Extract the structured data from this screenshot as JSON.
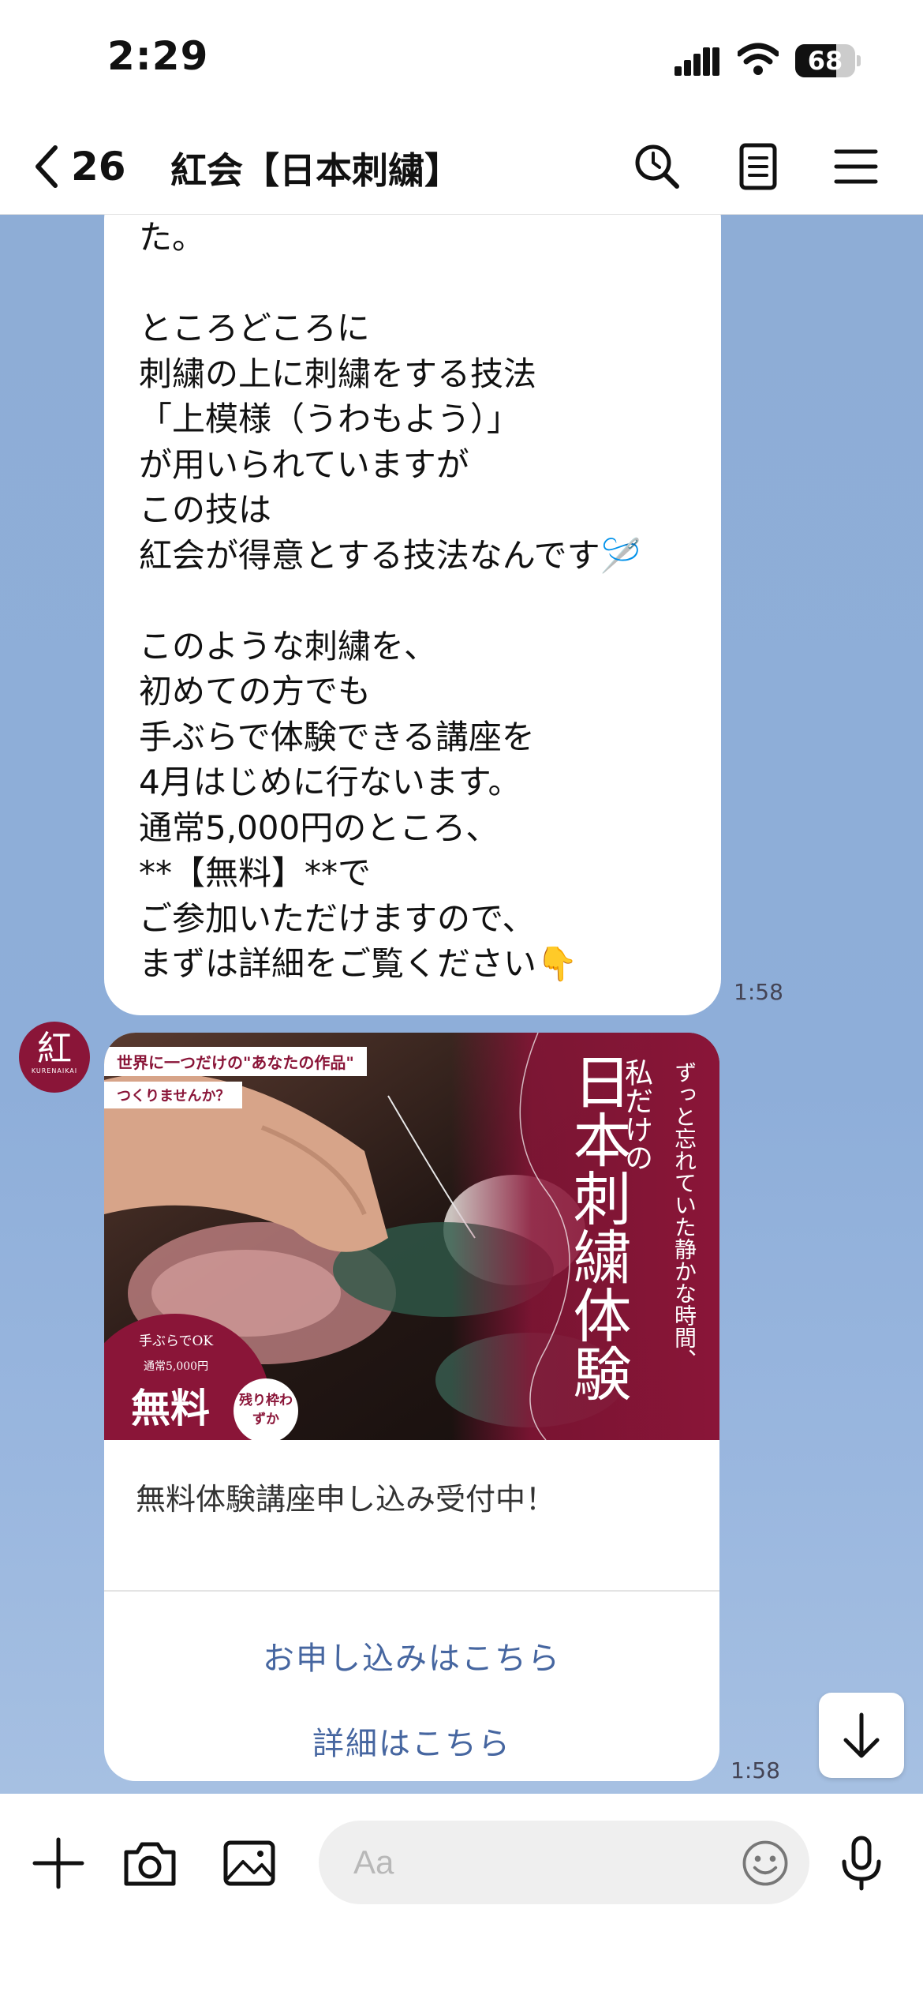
{
  "status": {
    "time": "2:29",
    "battery": "68",
    "battery_level": 0.68
  },
  "header": {
    "back_count": "26",
    "title": "紅会【日本刺繍】"
  },
  "message": {
    "lines": [
      "た。",
      "",
      "ところどころに",
      "刺繍の上に刺繍をする技法",
      "「上模様（うわもよう）」",
      "が用いられていますが",
      "この技は",
      "紅会が得意とする技法なんです🪡",
      "",
      "このような刺繍を、",
      "初めての方でも",
      "手ぶらで体験できる講座を",
      "4月はじめに行ないます。",
      "通常5,000円のところ、",
      "**【無料】**で",
      "ご参加いただけますので、",
      "まずは詳細をご覧ください👇"
    ],
    "time": "1:58"
  },
  "avatar": {
    "kanji": "紅",
    "sub": "KURENAIKAI"
  },
  "card": {
    "banner": {
      "tag1": "世界に一つだけの\"あなたの作品\"",
      "tag2": "つくりませんか？",
      "title_top": "私だけの",
      "title_main": "日本刺繍体験",
      "subtitle": "ずっと忘れていた静かな時間、",
      "free_hint": "手ぶらでOK",
      "regular_price": "通常5,000円",
      "free": "無料",
      "remaining": "残り枠わずか"
    },
    "text": "無料体験講座申し込み受付中！",
    "action_apply": "お申し込みはこちら",
    "action_details": "詳細はこちら",
    "time": "1:58"
  },
  "input": {
    "placeholder": "Aa"
  },
  "colors": {
    "chat_bg": "#8eadd6",
    "brand": "#8a1538",
    "link": "#4666a0"
  },
  "icons": [
    "back-chevron-icon",
    "search-icon",
    "notes-icon",
    "menu-icon",
    "scroll-down-arrow-icon",
    "plus-icon",
    "camera-icon",
    "image-icon",
    "emoji-icon",
    "microphone-icon"
  ]
}
